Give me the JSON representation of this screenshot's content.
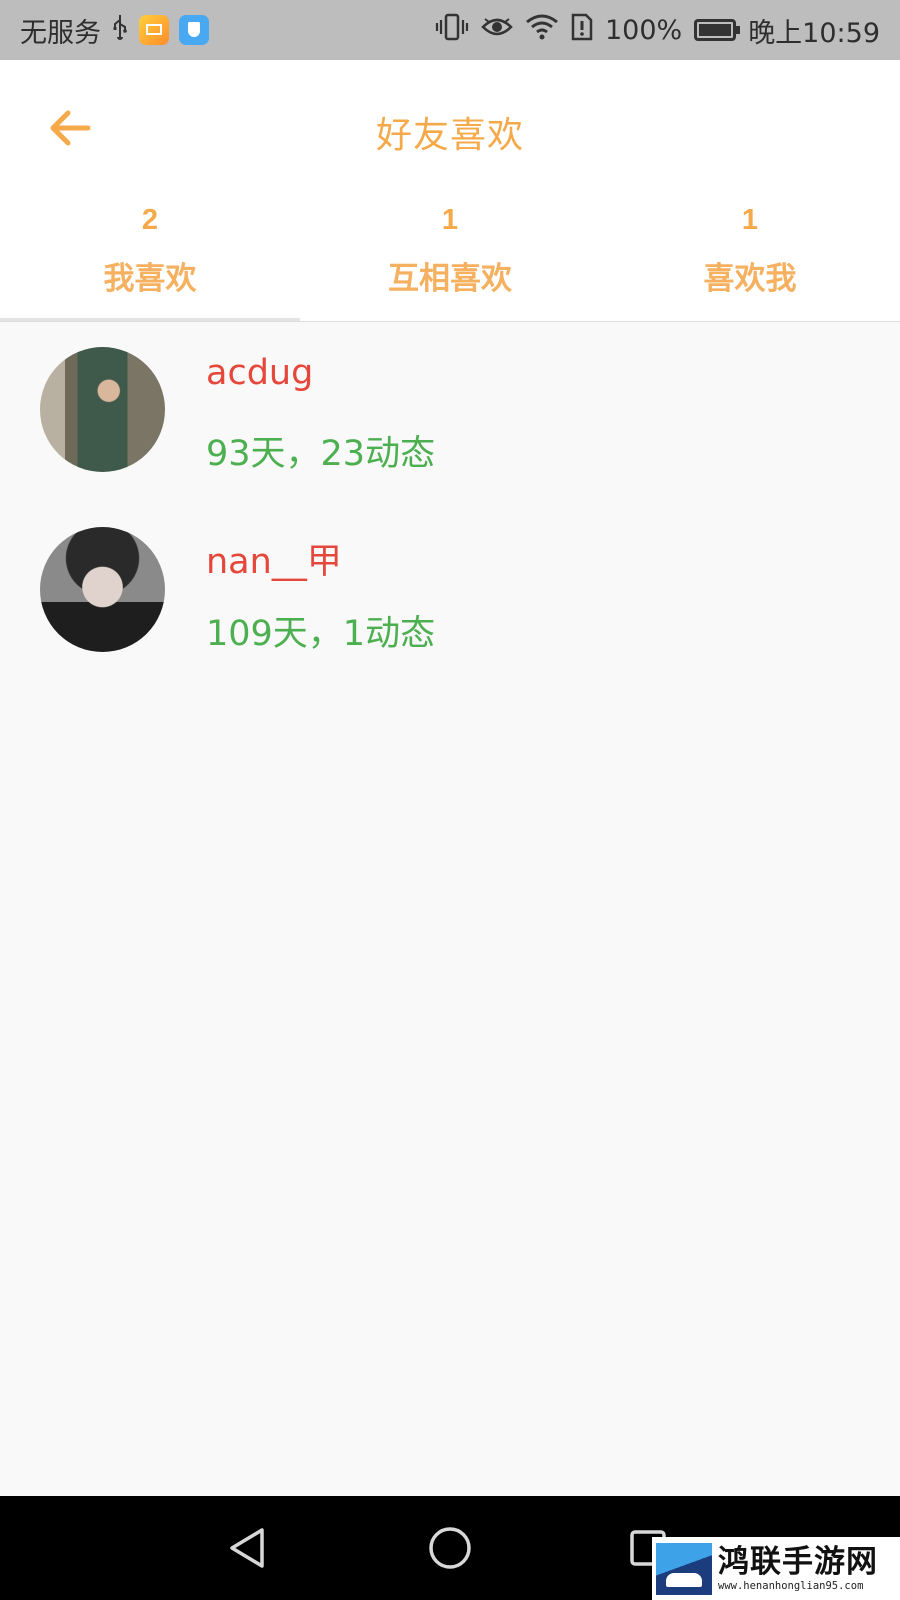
{
  "status_bar": {
    "carrier": "无服务",
    "battery_percent": "100%",
    "time": "晚上10:59",
    "icons": [
      "usb-icon",
      "mail-app-icon",
      "shield-app-icon",
      "vibrate-icon",
      "eye-icon",
      "wifi-icon",
      "sim-alert-icon",
      "battery-icon"
    ]
  },
  "header": {
    "back_icon": "arrow-left-icon",
    "title": "好友喜欢"
  },
  "tabs": [
    {
      "count": "2",
      "label": "我喜欢",
      "selected": true
    },
    {
      "count": "1",
      "label": "互相喜欢",
      "selected": false
    },
    {
      "count": "1",
      "label": "喜欢我",
      "selected": false
    }
  ],
  "friends": [
    {
      "name": "acdug",
      "meta": "93天，23动态"
    },
    {
      "name": "nan__甲",
      "meta": "109天，1动态"
    }
  ],
  "nav_bar": {
    "icons": [
      "back-triangle-icon",
      "home-circle-icon",
      "recents-square-icon"
    ]
  },
  "watermark": {
    "name": "鸿联手游网",
    "url": "www.henanhonglian95.com"
  },
  "colors": {
    "accent": "#f5a948",
    "name": "#e5473b",
    "meta": "#4caf50",
    "status_bar": "#bdbdbd",
    "background": "#f9f9f9"
  }
}
